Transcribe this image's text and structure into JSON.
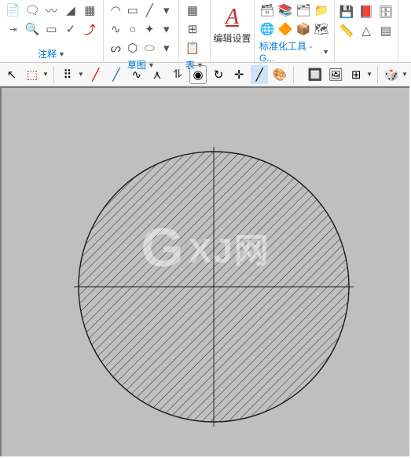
{
  "ribbon": {
    "annotation": {
      "label": "注释"
    },
    "sketch": {
      "label": "草图"
    },
    "table": {
      "label": "表"
    },
    "std_tools": {
      "label": "标准化工具 - G..."
    },
    "edit_settings_label": "编辑设置",
    "edit_settings_glyph": "A"
  },
  "watermark": {
    "g": "G",
    "text": "XJ网"
  }
}
